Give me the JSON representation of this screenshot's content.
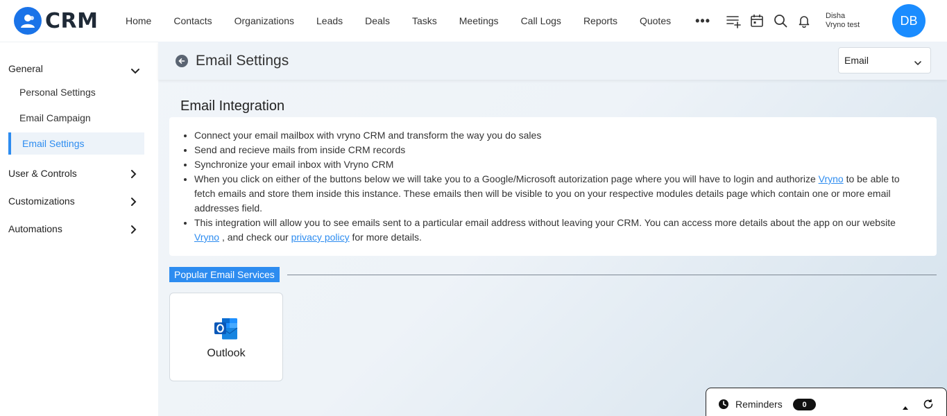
{
  "app": {
    "logo_text": "CRM"
  },
  "nav": {
    "items": [
      "Home",
      "Contacts",
      "Organizations",
      "Leads",
      "Deals",
      "Tasks",
      "Meetings",
      "Call Logs",
      "Reports",
      "Quotes"
    ],
    "more": "•••"
  },
  "user": {
    "first_line": "Disha",
    "second_line": "Vryno test",
    "initials": "DB"
  },
  "sidebar": {
    "general": "General",
    "sub_items": [
      "Personal Settings",
      "Email Campaign",
      "Email Settings"
    ],
    "sections": [
      "User & Controls",
      "Customizations",
      "Automations"
    ]
  },
  "page": {
    "title": "Email Settings",
    "select_value": "Email",
    "section_title": "Email Integration",
    "bullets": {
      "b1": "Connect your email mailbox with vryno CRM and transform the way you do sales",
      "b2": "Send and recieve mails from inside CRM records",
      "b3": "Synchronize your email inbox with Vryno CRM",
      "b4_pre": "When you click on either of the buttons below we will take you to a Google/Microsoft autorization page where you will have to login and authorize ",
      "b4_link": "Vryno",
      "b4_post": " to be able to fetch emails and store them inside this instance. These emails then will be visible to you on your respective modules details page which contain one or more email addresses field.",
      "b5_pre": "This integration will allow you to see emails sent to a particular email address without leaving your CRM. You can access more details about the app on our website ",
      "b5_link1": "Vryno",
      "b5_mid": " , and check our ",
      "b5_link2": "privacy policy",
      "b5_post": " for more details."
    },
    "popular_label": "Popular Email Services",
    "services": [
      {
        "label": "Outlook"
      }
    ]
  },
  "reminders": {
    "label": "Reminders",
    "count": "0"
  }
}
